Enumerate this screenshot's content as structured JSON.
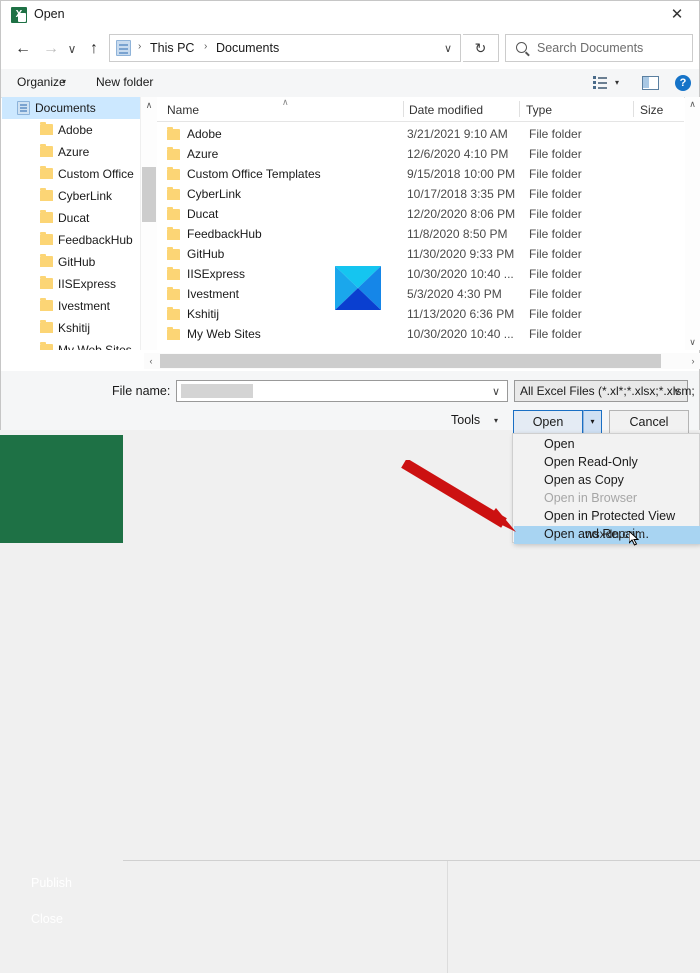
{
  "dialog": {
    "title": "Open",
    "app_icon": "excel-icon",
    "close_label": "✕"
  },
  "nav": {
    "back": "←",
    "forward": "→",
    "recent": "∨",
    "up": "↑",
    "breadcrumb": [
      "This PC",
      "Documents"
    ],
    "separator": "›",
    "dropdown_chevron": "∨",
    "refresh": "↻"
  },
  "search": {
    "placeholder": "Search Documents",
    "icon": "search-icon"
  },
  "commandbar": {
    "organize": "Organize",
    "organize_caret": "▾",
    "new_folder": "New folder",
    "view_caret": "▾",
    "help": "?"
  },
  "sidebar": {
    "root": {
      "label": "Documents",
      "icon": "documents-icon",
      "selected": true
    },
    "items": [
      {
        "label": "Adobe"
      },
      {
        "label": "Azure"
      },
      {
        "label": "Custom Office"
      },
      {
        "label": "CyberLink"
      },
      {
        "label": "Ducat"
      },
      {
        "label": "FeedbackHub"
      },
      {
        "label": "GitHub"
      },
      {
        "label": "IISExpress"
      },
      {
        "label": "Ivestment"
      },
      {
        "label": "Kshitij"
      },
      {
        "label": "My Web Sites"
      }
    ],
    "scroll_up": "∧"
  },
  "filelist": {
    "columns": [
      "Name",
      "Date modified",
      "Type",
      "Size"
    ],
    "sort_indicator": "∧",
    "rows": [
      {
        "name": "Adobe",
        "date": "3/21/2021 9:10 AM",
        "type": "File folder",
        "size": ""
      },
      {
        "name": "Azure",
        "date": "12/6/2020 4:10 PM",
        "type": "File folder",
        "size": ""
      },
      {
        "name": "Custom Office Templates",
        "date": "9/15/2018 10:00 PM",
        "type": "File folder",
        "size": ""
      },
      {
        "name": "CyberLink",
        "date": "10/17/2018 3:35 PM",
        "type": "File folder",
        "size": ""
      },
      {
        "name": "Ducat",
        "date": "12/20/2020 8:06 PM",
        "type": "File folder",
        "size": ""
      },
      {
        "name": "FeedbackHub",
        "date": "11/8/2020 8:50 PM",
        "type": "File folder",
        "size": ""
      },
      {
        "name": "GitHub",
        "date": "11/30/2020 9:33 PM",
        "type": "File folder",
        "size": ""
      },
      {
        "name": "IISExpress",
        "date": "10/30/2020 10:40 ...",
        "type": "File folder",
        "size": ""
      },
      {
        "name": "Ivestment",
        "date": "5/3/2020 4:30 PM",
        "type": "File folder",
        "size": ""
      },
      {
        "name": "Kshitij",
        "date": "11/13/2020 6:36 PM",
        "type": "File folder",
        "size": ""
      },
      {
        "name": "My Web Sites",
        "date": "10/30/2020 10:40 ...",
        "type": "File folder",
        "size": ""
      }
    ],
    "scroll_up": "∧",
    "scroll_down": "∨",
    "hscroll_left": "‹",
    "hscroll_right": "›"
  },
  "footer": {
    "filename_label": "File name:",
    "filename_value": "",
    "filename_chevron": "∨",
    "filetype_value": "All Excel Files (*.xl*;*.xlsx;*.xlsm;",
    "filetype_chevron": "∨",
    "tools_label": "Tools",
    "tools_caret": "▾",
    "open_label": "Open",
    "open_split_caret": "▾",
    "cancel_label": "Cancel"
  },
  "open_menu": {
    "items": [
      {
        "label": "Open",
        "disabled": false,
        "selected": false
      },
      {
        "label": "Open Read-Only",
        "disabled": false,
        "selected": false
      },
      {
        "label": "Open as Copy",
        "disabled": false,
        "selected": false
      },
      {
        "label": "Open in Browser",
        "disabled": true,
        "selected": false
      },
      {
        "label": "Open in Protected View",
        "disabled": false,
        "selected": false
      },
      {
        "label": "Open and Repair...",
        "disabled": false,
        "selected": true
      }
    ]
  },
  "backstage": {
    "publish": "Publish",
    "close": "Close",
    "accent_color": "#1e7145"
  },
  "annotations": {
    "arrow_color": "#cc1111",
    "watermark": "wsxdn.com"
  }
}
